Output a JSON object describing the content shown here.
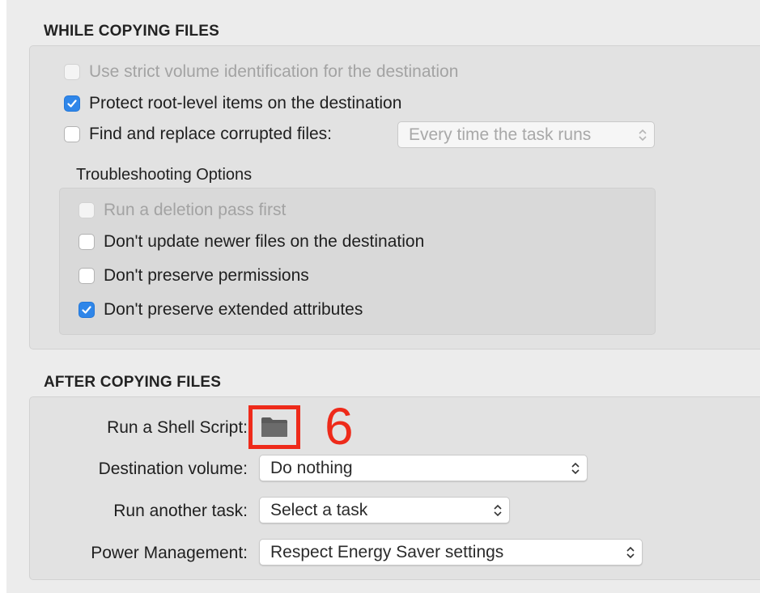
{
  "while_copying": {
    "title": "WHILE COPYING FILES",
    "options": [
      {
        "label": "Use strict volume identification for the destination",
        "checked": false,
        "enabled": false
      },
      {
        "label": "Protect root-level items on the destination",
        "checked": true,
        "enabled": true
      },
      {
        "label": "Find and replace corrupted files:",
        "checked": false,
        "enabled": true
      }
    ],
    "corrupted_files_popup": {
      "value": "Every time the task runs",
      "enabled": false
    },
    "troubleshooting": {
      "title": "Troubleshooting Options",
      "options": [
        {
          "label": "Run a deletion pass first",
          "checked": false,
          "enabled": false
        },
        {
          "label": "Don't update newer files on the destination",
          "checked": false,
          "enabled": true
        },
        {
          "label": "Don't preserve permissions",
          "checked": false,
          "enabled": true
        },
        {
          "label": "Don't preserve extended attributes",
          "checked": true,
          "enabled": true
        }
      ]
    }
  },
  "after_copying": {
    "title": "AFTER COPYING FILES",
    "shell_script_label": "Run a Shell Script:",
    "shell_script_icon": "folder-icon",
    "destination_volume": {
      "label": "Destination volume:",
      "value": "Do nothing"
    },
    "run_another_task": {
      "label": "Run another task:",
      "value": "Select a task"
    },
    "power_management": {
      "label": "Power Management:",
      "value": "Respect Energy Saver settings"
    }
  },
  "annotation": {
    "number": "6",
    "color": "#ee2a1a"
  },
  "colors": {
    "checkbox_checked": "#2f86e9",
    "panel": "#e2e2e2",
    "window": "#ececec"
  }
}
